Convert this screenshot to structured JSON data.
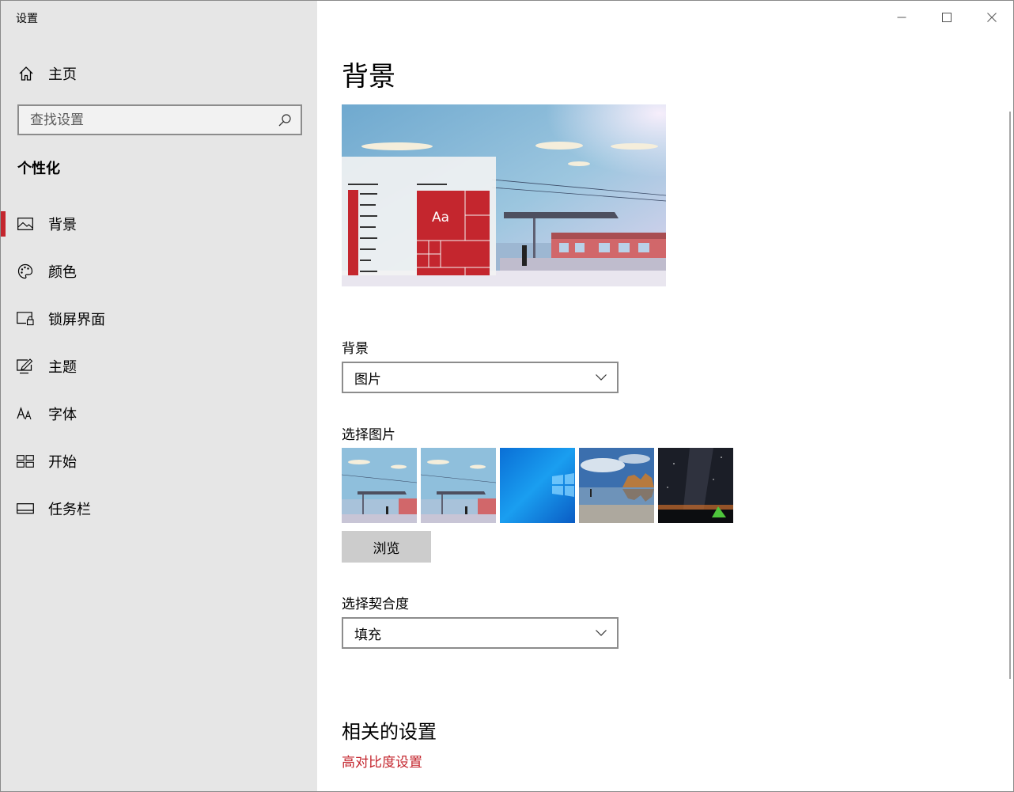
{
  "window": {
    "title": "设置"
  },
  "sidebar": {
    "home_label": "主页",
    "search_placeholder": "查找设置",
    "section_title": "个性化",
    "items": [
      {
        "label": "背景",
        "icon": "picture-icon",
        "active": true
      },
      {
        "label": "颜色",
        "icon": "palette-icon",
        "active": false
      },
      {
        "label": "锁屏界面",
        "icon": "lock-screen-icon",
        "active": false
      },
      {
        "label": "主题",
        "icon": "theme-edit-icon",
        "active": false
      },
      {
        "label": "字体",
        "icon": "font-icon",
        "active": false
      },
      {
        "label": "开始",
        "icon": "start-grid-icon",
        "active": false
      },
      {
        "label": "任务栏",
        "icon": "taskbar-icon",
        "active": false
      }
    ]
  },
  "main": {
    "page_title": "背景",
    "preview": {
      "tile_text": "Aa"
    },
    "background": {
      "label": "背景",
      "value": "图片"
    },
    "choose_picture": {
      "label": "选择图片",
      "browse_label": "浏览"
    },
    "fit": {
      "label": "选择契合度",
      "value": "填充"
    },
    "related": {
      "title": "相关的设置",
      "link": "高对比度设置"
    }
  },
  "colors": {
    "accent": "#c4262e",
    "sidebar_bg": "#e6e6e6",
    "main_bg": "#ffffff"
  }
}
